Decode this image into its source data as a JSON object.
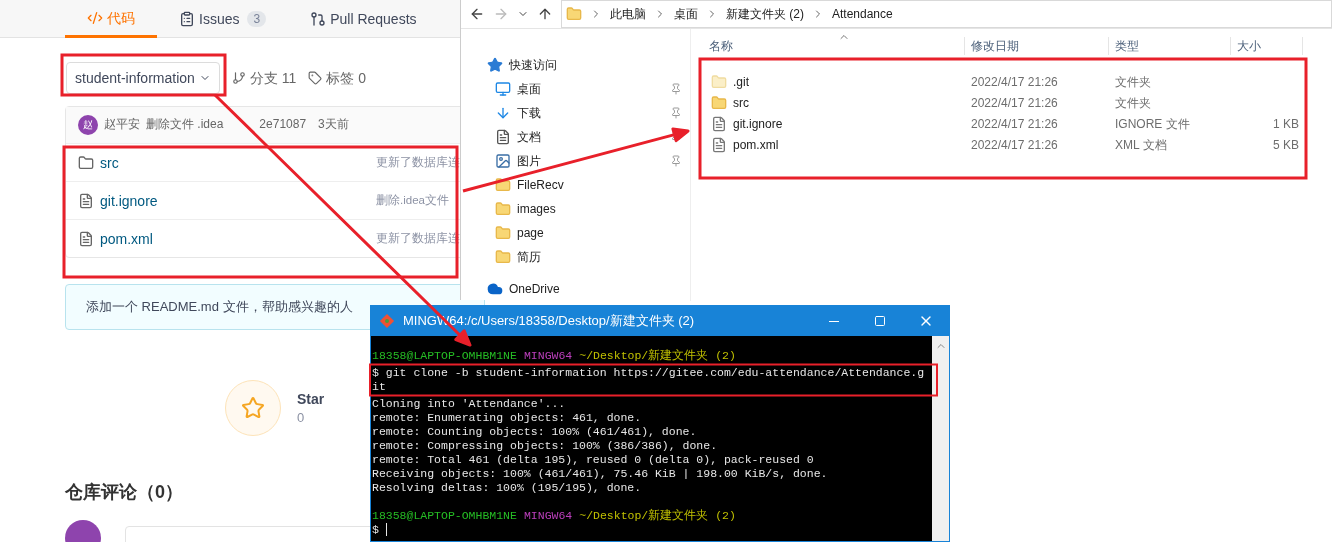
{
  "repo_page": {
    "tabs": [
      {
        "kind": "code",
        "label": "代码",
        "selected": true
      },
      {
        "kind": "issues",
        "label": "Issues",
        "count": "3",
        "selected": false
      },
      {
        "kind": "pulls",
        "label": "Pull Requests",
        "selected": false
      }
    ],
    "branch": "student-information",
    "branches": "分支 11",
    "tags": "标签 0",
    "commit": {
      "avatar": "赵",
      "author": "赵平安",
      "message": "删除文件 .idea",
      "hash": "2e71087",
      "time": "3天前"
    },
    "files": [
      {
        "kind": "folder",
        "name": "src",
        "message": "更新了数据库连"
      },
      {
        "kind": "file",
        "name": "git.ignore",
        "message": "删除.idea文件"
      },
      {
        "kind": "file",
        "name": "pom.xml",
        "message": "更新了数据库连"
      }
    ],
    "readme_hint": "添加一个 README.md 文件，帮助感兴趣的人",
    "star": {
      "label": "Star",
      "count": "0"
    },
    "comments_heading": "仓库评论（0）"
  },
  "explorer": {
    "path": [
      "此电脑",
      "桌面",
      "新建文件夹 (2)",
      "Attendance"
    ],
    "nav": [
      {
        "kind": "star",
        "label": "快速访问",
        "pinned": false
      },
      {
        "kind": "desktop",
        "label": "桌面",
        "pinned": true
      },
      {
        "kind": "download",
        "label": "下载",
        "pinned": true
      },
      {
        "kind": "document",
        "label": "文档",
        "pinned": true
      },
      {
        "kind": "pictures",
        "label": "图片",
        "pinned": true
      },
      {
        "kind": "folder",
        "label": "FileRecv",
        "pinned": false
      },
      {
        "kind": "folder",
        "label": "images",
        "pinned": false
      },
      {
        "kind": "folder",
        "label": "page",
        "pinned": false
      },
      {
        "kind": "folder",
        "label": "简历",
        "pinned": false
      },
      {
        "kind": "cloud",
        "label": "OneDrive",
        "pinned": false
      }
    ],
    "columns": [
      "名称",
      "修改日期",
      "类型",
      "大小"
    ],
    "rows": [
      {
        "kind": "folder",
        "hidden": true,
        "name": ".git",
        "date": "2022/4/17 21:26",
        "type": "文件夹"
      },
      {
        "kind": "folder",
        "hidden": false,
        "name": "src",
        "date": "2022/4/17 21:26",
        "type": "文件夹"
      },
      {
        "kind": "file",
        "name": "git.ignore",
        "date": "2022/4/17 21:26",
        "type": "IGNORE 文件",
        "size": "1 KB"
      },
      {
        "kind": "file",
        "name": "pom.xml",
        "date": "2022/4/17 21:26",
        "type": "XML 文档",
        "size": "5 KB"
      }
    ]
  },
  "terminal": {
    "title": "MINGW64:/c/Users/18358/Desktop/新建文件夹 (2)",
    "lines": [
      {
        "kind": "prompt",
        "segments": [
          {
            "kind": "user",
            "text": "18358@LAPTOP-OMHBM1NE"
          },
          {
            "kind": "shell",
            "text": "MINGW64"
          },
          {
            "kind": "path",
            "text": "~/Desktop/新建文件夹 (2)"
          }
        ]
      },
      {
        "kind": "command",
        "segments": [
          {
            "kind": "plain",
            "text": "$ git clone -b student-information https://gitee.com/edu-attendance/Attendance.g"
          }
        ]
      },
      {
        "kind": "command",
        "segments": [
          {
            "kind": "plain",
            "text": "it"
          }
        ]
      },
      {
        "kind": "text",
        "segments": [
          {
            "kind": "plain",
            "text": "Cloning into 'Attendance'..."
          }
        ]
      },
      {
        "kind": "text",
        "segments": [
          {
            "kind": "plain",
            "text": "remote: Enumerating objects: 461, done."
          }
        ]
      },
      {
        "kind": "text",
        "segments": [
          {
            "kind": "plain",
            "text": "remote: Counting objects: 100% (461/461), done."
          }
        ]
      },
      {
        "kind": "text",
        "segments": [
          {
            "kind": "plain",
            "text": "remote: Compressing objects: 100% (386/386), done."
          }
        ]
      },
      {
        "kind": "text",
        "segments": [
          {
            "kind": "plain",
            "text": "remote: Total 461 (delta 195), reused 0 (delta 0), pack-reused 0"
          }
        ]
      },
      {
        "kind": "text",
        "segments": [
          {
            "kind": "plain",
            "text": "Receiving objects: 100% (461/461), 75.46 KiB | 198.00 KiB/s, done."
          }
        ]
      },
      {
        "kind": "text",
        "segments": [
          {
            "kind": "plain",
            "text": "Resolving deltas: 100% (195/195), done."
          }
        ]
      },
      {
        "kind": "blank"
      },
      {
        "kind": "prompt",
        "segments": [
          {
            "kind": "user",
            "text": "18358@LAPTOP-OMHBM1NE"
          },
          {
            "kind": "shell",
            "text": "MINGW64"
          },
          {
            "kind": "path",
            "text": "~/Desktop/新建文件夹 (2)"
          }
        ]
      },
      {
        "kind": "input",
        "segments": [
          {
            "kind": "plain",
            "text": "$"
          }
        ]
      }
    ]
  }
}
